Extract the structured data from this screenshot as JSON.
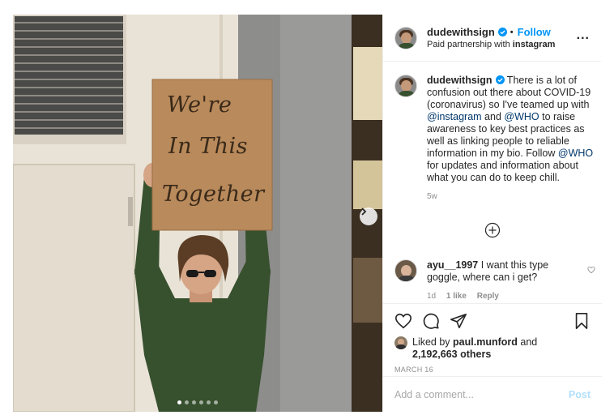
{
  "post": {
    "username": "dudewithsign",
    "follow_label": "Follow",
    "bullet": "•",
    "partnership_prefix": "Paid partnership with",
    "partnership_name": "instagram",
    "more_label": "...",
    "sign_lines": [
      "We're",
      "In This",
      "Together"
    ],
    "carousel": {
      "count": 6,
      "active_index": 0
    }
  },
  "caption": {
    "username": "dudewithsign",
    "text_1": " There is a lot of confusion out there about COVID-19 (coronavirus) so I've teamed up with ",
    "mention_1": "@instagram",
    "text_2": " and ",
    "mention_2": "@WHO",
    "text_3": " to raise awareness to key best practices as well as linking people to reliable information in my bio. Follow ",
    "mention_3": "@WHO",
    "text_4": " for updates and information about what you can do to keep chill.",
    "time": "5w"
  },
  "comment": {
    "username": "ayu__1997",
    "text": " I want this type goggle, where can i get?",
    "time": "1d",
    "likes": "1 like",
    "reply": "Reply"
  },
  "likes": {
    "prefix": "Liked by ",
    "user": "paul.munford",
    "and": " and",
    "count": "2,192,663 others"
  },
  "date": "MARCH 16",
  "add_comment": {
    "placeholder": "Add a comment...",
    "post_label": "Post"
  },
  "icons": {
    "header": [
      "verified-badge-icon",
      "more-options-icon"
    ],
    "actions": [
      "heart-icon",
      "comment-icon",
      "share-icon",
      "bookmark-icon"
    ],
    "other": [
      "carousel-next-icon",
      "load-more-comments-icon",
      "like-comment-icon"
    ]
  },
  "colors": {
    "accent": "#0095f6",
    "mention": "#00376b",
    "muted": "#8e8e8e",
    "post_disabled": "#b2dffc",
    "sign": "#b98a5b",
    "shirt": "#37502e"
  }
}
